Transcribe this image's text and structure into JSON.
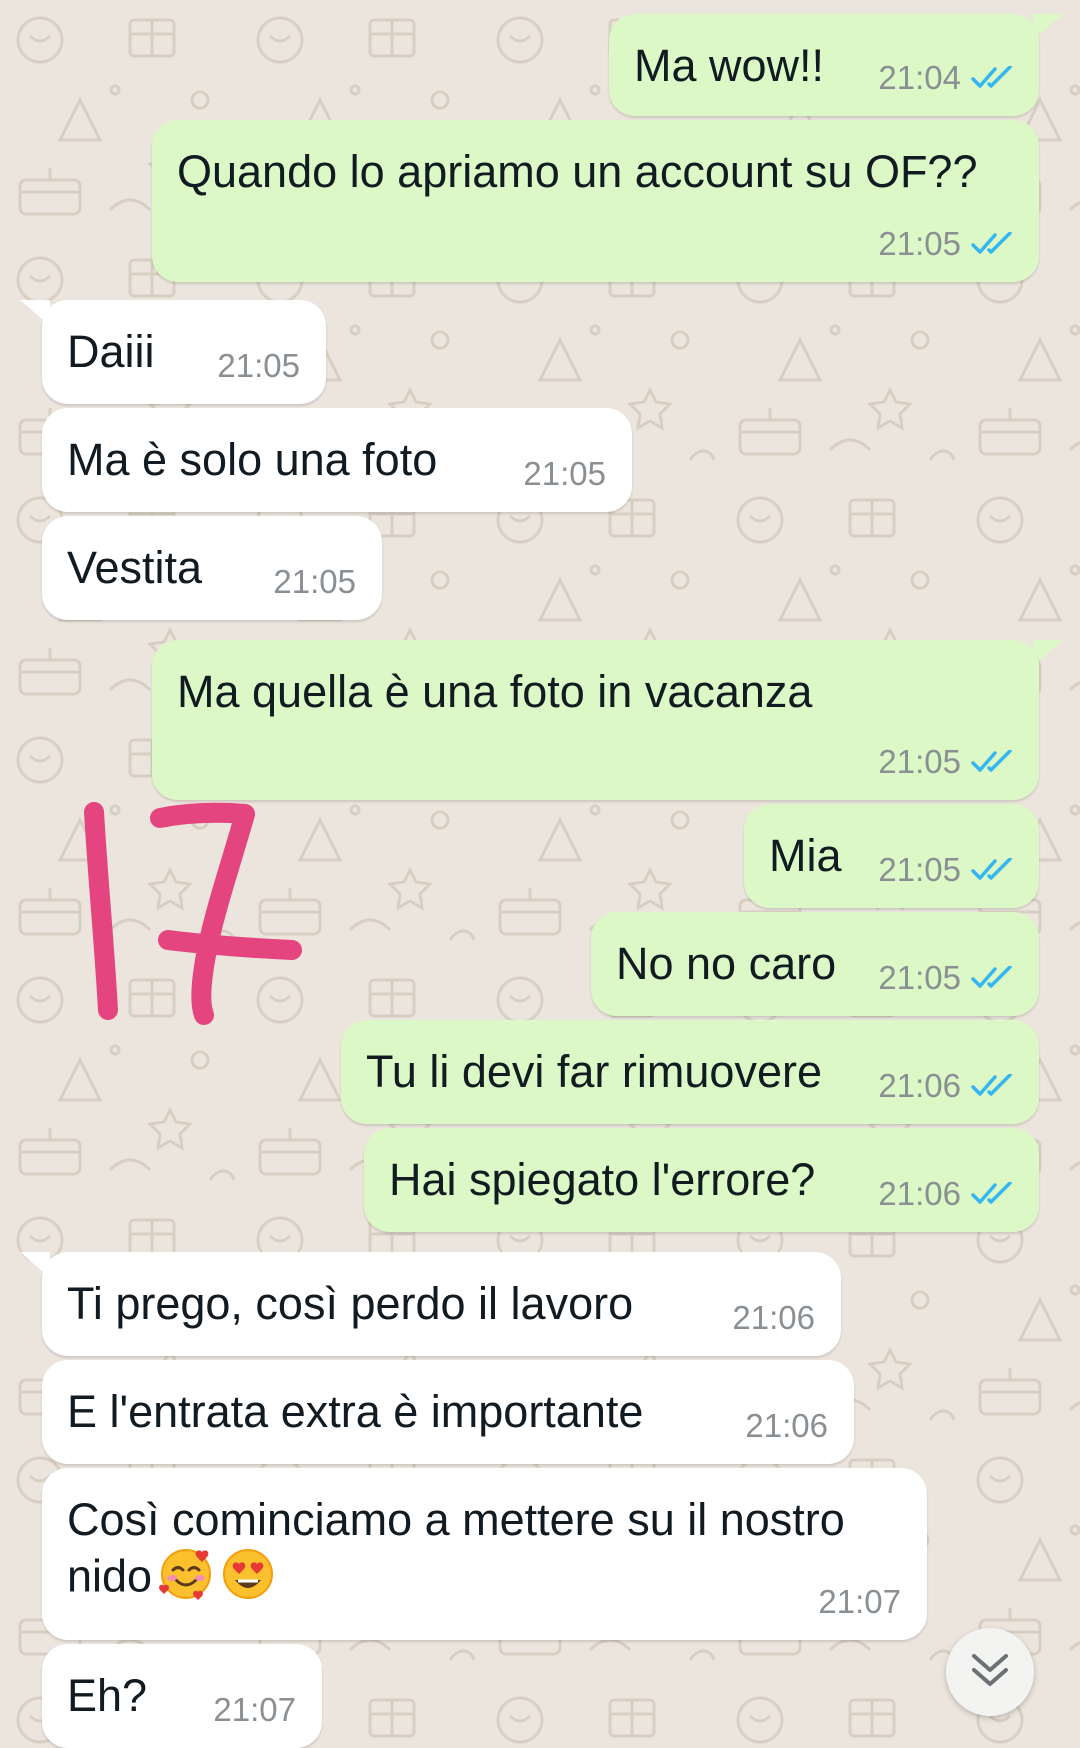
{
  "chat": {
    "messages": [
      {
        "id": "m1",
        "dir": "out",
        "text": "Ma wow!!",
        "time": "21:04",
        "read": true
      },
      {
        "id": "m2",
        "dir": "out",
        "text": "Quando lo apriamo un account su OF??",
        "time": "21:05",
        "read": true
      },
      {
        "id": "m3",
        "dir": "in",
        "text": "Daiii",
        "time": "21:05"
      },
      {
        "id": "m4",
        "dir": "in",
        "text": "Ma è solo una foto",
        "time": "21:05"
      },
      {
        "id": "m5",
        "dir": "in",
        "text": "Vestita",
        "time": "21:05"
      },
      {
        "id": "m6",
        "dir": "out",
        "text": "Ma quella è una foto in vacanza",
        "time": "21:05",
        "read": true
      },
      {
        "id": "m7",
        "dir": "out",
        "text": "Mia",
        "time": "21:05",
        "read": true
      },
      {
        "id": "m8",
        "dir": "out",
        "text": "No no caro",
        "time": "21:05",
        "read": true
      },
      {
        "id": "m9",
        "dir": "out",
        "text": "Tu li devi far rimuovere",
        "time": "21:06",
        "read": true
      },
      {
        "id": "m10",
        "dir": "out",
        "text": "Hai spiegato l'errore?",
        "time": "21:06",
        "read": true
      },
      {
        "id": "m11",
        "dir": "in",
        "text": "Ti prego, così perdo il lavoro",
        "time": "21:06"
      },
      {
        "id": "m12",
        "dir": "in",
        "text": "E l'entrata extra è importante",
        "time": "21:06"
      },
      {
        "id": "m13",
        "dir": "in",
        "text": "Così cominciamo a mettere su il nostro nido",
        "time": "21:07",
        "emojis": [
          "smiling-face-with-hearts-emoji",
          "heart-eyes-emoji"
        ]
      },
      {
        "id": "m14",
        "dir": "in",
        "text": "Eh?",
        "time": "21:07"
      }
    ]
  },
  "annotation": {
    "handwritten_text": "17",
    "color": "#e5457f"
  },
  "scroll_button": {
    "icon": "double-chevron-down-icon"
  },
  "colors": {
    "outgoing_bubble": "#dcf8c6",
    "incoming_bubble": "#ffffff",
    "chat_background": "#ece5dd",
    "read_ticks": "#34b7f1",
    "timestamp": "#8a8f93"
  }
}
